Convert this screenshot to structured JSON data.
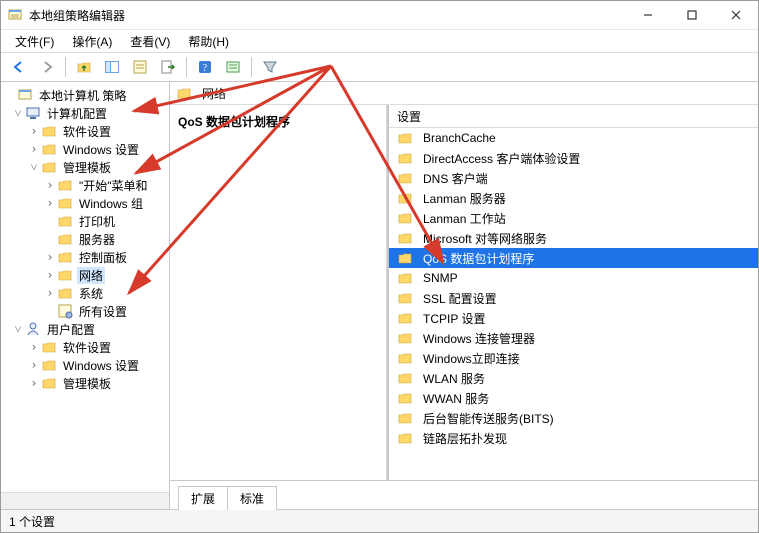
{
  "window": {
    "title": "本地组策略编辑器"
  },
  "menubar": {
    "file": "文件(F)",
    "action": "操作(A)",
    "view": "查看(V)",
    "help": "帮助(H)"
  },
  "tree": {
    "root": "本地计算机 策略",
    "n1": "计算机配置",
    "n1_1": "软件设置",
    "n1_2": "Windows 设置",
    "n1_3": "管理模板",
    "n1_3_1": "\"开始\"菜单和",
    "n1_3_2": "Windows 组",
    "n1_3_3": "打印机",
    "n1_3_4": "服务器",
    "n1_3_5": "控制面板",
    "n1_3_6": "网络",
    "n1_3_7": "系统",
    "n1_3_8": "所有设置",
    "n2": "用户配置",
    "n2_1": "软件设置",
    "n2_2": "Windows 设置",
    "n2_3": "管理模板"
  },
  "breadcrumb": {
    "label": "网络"
  },
  "desc": {
    "title": "QoS 数据包计划程序"
  },
  "listhead": {
    "col": "设置"
  },
  "items": {
    "i0": "BranchCache",
    "i1": "DirectAccess 客户端体验设置",
    "i2": "DNS 客户端",
    "i3": "Lanman 服务器",
    "i4": "Lanman 工作站",
    "i5": "Microsoft 对等网络服务",
    "i6": "QoS 数据包计划程序",
    "i7": "SNMP",
    "i8": "SSL 配置设置",
    "i9": "TCPIP 设置",
    "i10": "Windows 连接管理器",
    "i11": "Windows立即连接",
    "i12": "WLAN 服务",
    "i13": "WWAN 服务",
    "i14": "后台智能传送服务(BITS)",
    "i15": "链路层拓扑发现"
  },
  "tabs": {
    "t0": "扩展",
    "t1": "标准"
  },
  "status": {
    "text": "1 个设置"
  },
  "selected_index": 6,
  "colors": {
    "selection_bg": "#1e74e6",
    "selection_fg": "#ffffff",
    "tree_sel_bg": "#cfe6ff",
    "arrow": "#d63a2a"
  }
}
